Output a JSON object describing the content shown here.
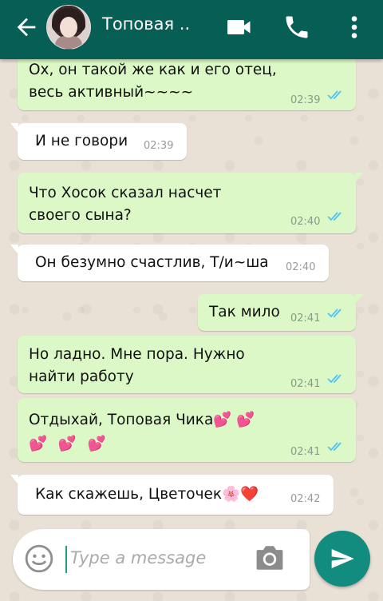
{
  "header": {
    "title": "Топовая ..",
    "back_icon": "arrow-left-icon",
    "video_icon": "video-camera-icon",
    "call_icon": "phone-icon",
    "menu_icon": "more-vert-icon"
  },
  "messages": [
    {
      "dir": "out",
      "lines": [
        "Ох, он такой же как и его отец,",
        "весь активный~~~~"
      ],
      "time": "02:39",
      "status": "read"
    },
    {
      "dir": "in",
      "lines": [
        "И не говори"
      ],
      "time": "02:39"
    },
    {
      "dir": "out",
      "lines": [
        "Что Хосок сказал насчет",
        "своего сына?"
      ],
      "time": "02:40",
      "status": "read"
    },
    {
      "dir": "in",
      "lines": [
        "Он безумно счастлив, Т/и~ша"
      ],
      "time": "02:40"
    },
    {
      "dir": "out",
      "lines": [
        "Так мило"
      ],
      "time": "02:41",
      "status": "read"
    },
    {
      "dir": "out",
      "lines": [
        "Но ладно. Мне пора. Нужно",
        "найти работу"
      ],
      "time": "02:41",
      "status": "read"
    },
    {
      "dir": "out",
      "lines": [
        "Отдыхай, Топовая Чика💕 💕",
        "💕 💕 💕"
      ],
      "time": "02:41",
      "status": "read"
    },
    {
      "dir": "in",
      "lines": [
        "Как скажешь, Цветочек🌸❤️"
      ],
      "time": "02:42"
    }
  ],
  "composer": {
    "placeholder": "Type a message",
    "emoji_icon": "emoji-smiley-icon",
    "camera_icon": "camera-icon",
    "send_icon": "send-icon"
  },
  "colors": {
    "header": "#075e54",
    "outgoing": "#dcf8c6",
    "incoming": "#ffffff",
    "read_tick": "#4fc3f7",
    "send": "#128c7e"
  }
}
